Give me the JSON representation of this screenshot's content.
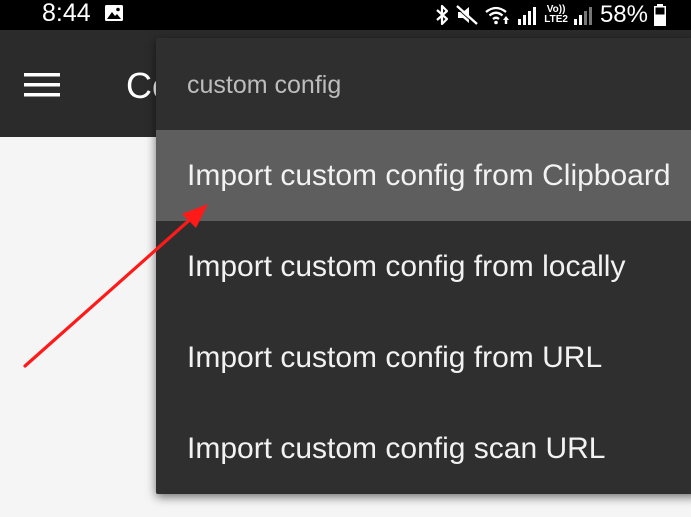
{
  "status_bar": {
    "time": "8:44",
    "battery": "58%",
    "icons": [
      "gallery-icon",
      "bluetooth-icon",
      "mute-icon",
      "wifi-icon",
      "signal-icon",
      "volte-icon",
      "signal-icon",
      "battery-icon"
    ],
    "volte_line1": "Vo))",
    "volte_line2": "LTE2"
  },
  "toolbar": {
    "title": "Co",
    "menu_icon": "hamburger-menu-icon",
    "background": "#2b2b2b"
  },
  "popup": {
    "header": "custom config",
    "background": "#2f2f2f",
    "selected_background": "#5e5e5e",
    "items": [
      {
        "label": "Import custom config from Clipboard",
        "selected": true
      },
      {
        "label": "Import custom config from locally",
        "selected": false
      },
      {
        "label": "Import custom config from URL",
        "selected": false
      },
      {
        "label": "Import custom config scan URL",
        "selected": false
      }
    ]
  },
  "annotation": {
    "arrow_color": "#ff1a1a",
    "icon": "red-arrow-annotation"
  }
}
